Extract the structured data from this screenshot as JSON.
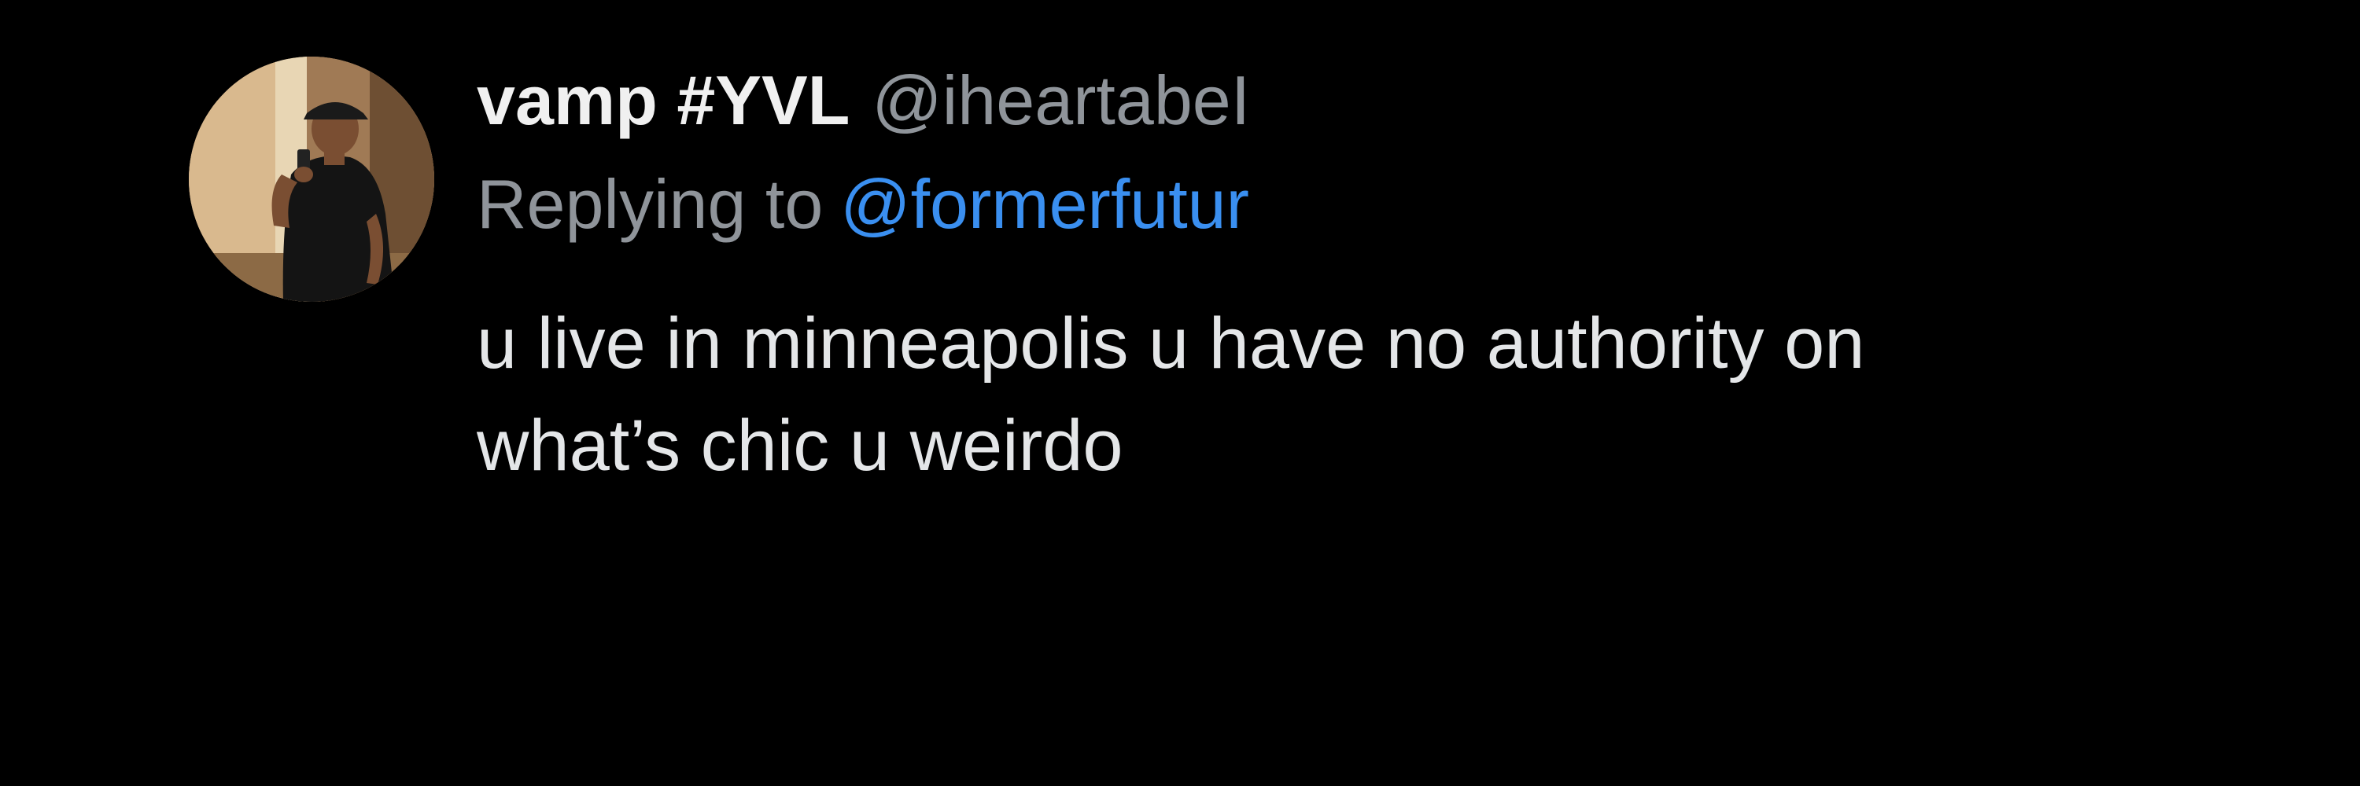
{
  "tweet": {
    "author": {
      "display_name": "vamp #YVL",
      "handle": "@iheartabeI",
      "avatar_icon": "user-avatar-photo"
    },
    "reply": {
      "prefix": "Replying to",
      "mention": "@formerfutur"
    },
    "text_lines": [
      "u live in minneapolis u have no authority on",
      "what’s chic u weirdo"
    ]
  },
  "colors": {
    "background": "#000000",
    "primary_text": "#e7e9ea",
    "secondary_text": "#8f949a",
    "link": "#3a8ff0"
  }
}
